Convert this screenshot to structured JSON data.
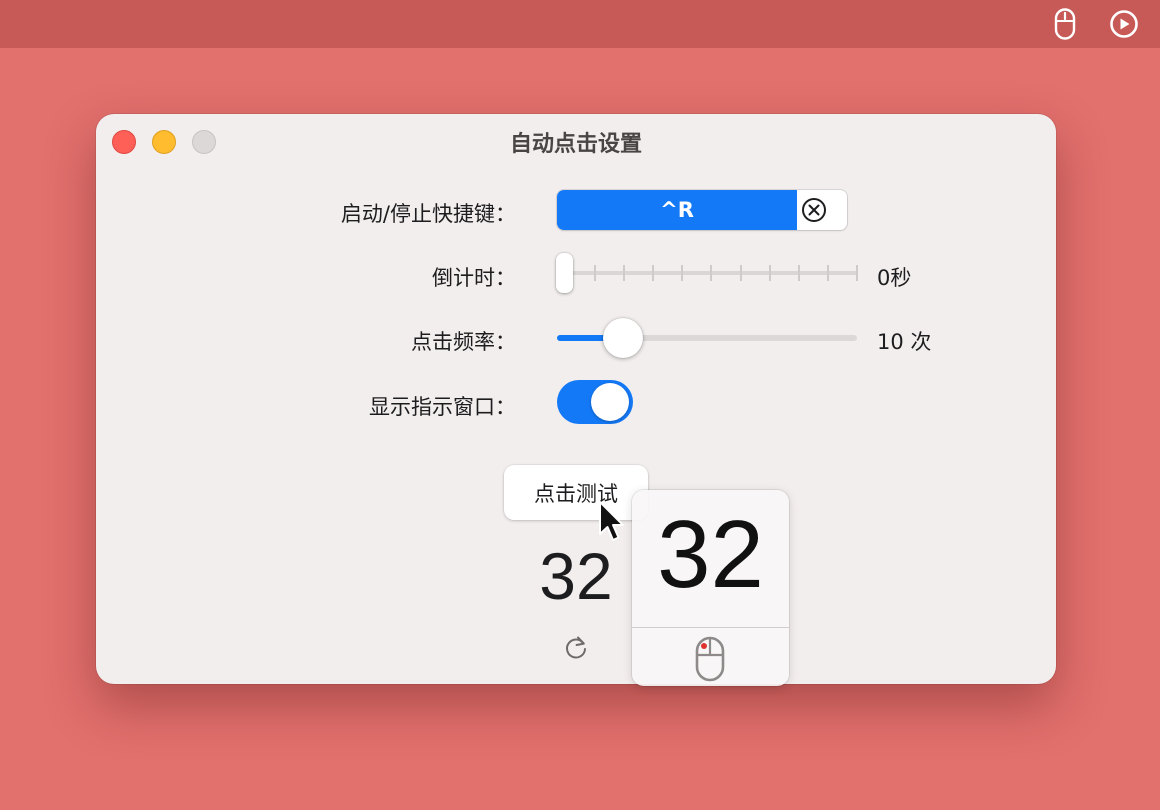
{
  "menubar": {
    "icons": [
      "mouse-icon",
      "play-circle-icon"
    ]
  },
  "window": {
    "title": "自动点击设置",
    "controls": [
      "close",
      "minimize",
      "zoom"
    ]
  },
  "settings": {
    "shortcut": {
      "label": "启动/停止快捷键：",
      "value": "^R",
      "clear_icon": "circle-x-icon"
    },
    "countdown": {
      "label": "倒计时：",
      "value_text": "0秒",
      "position": 0,
      "tick_count": 10
    },
    "frequency": {
      "label": "点击频率：",
      "value_text": "10 次",
      "fraction": 0.22
    },
    "indicator": {
      "label": "显示指示窗口：",
      "enabled": true
    }
  },
  "test": {
    "button_label": "点击测试",
    "count": "32",
    "reset_icon": "refresh-icon"
  },
  "indicator_window": {
    "count": "32",
    "icon": "mouse-left-click-icon"
  },
  "colors": {
    "accent": "#1479f6",
    "background": "#e2706d",
    "menubar": "#c75a57",
    "window": "#f3eeee"
  }
}
